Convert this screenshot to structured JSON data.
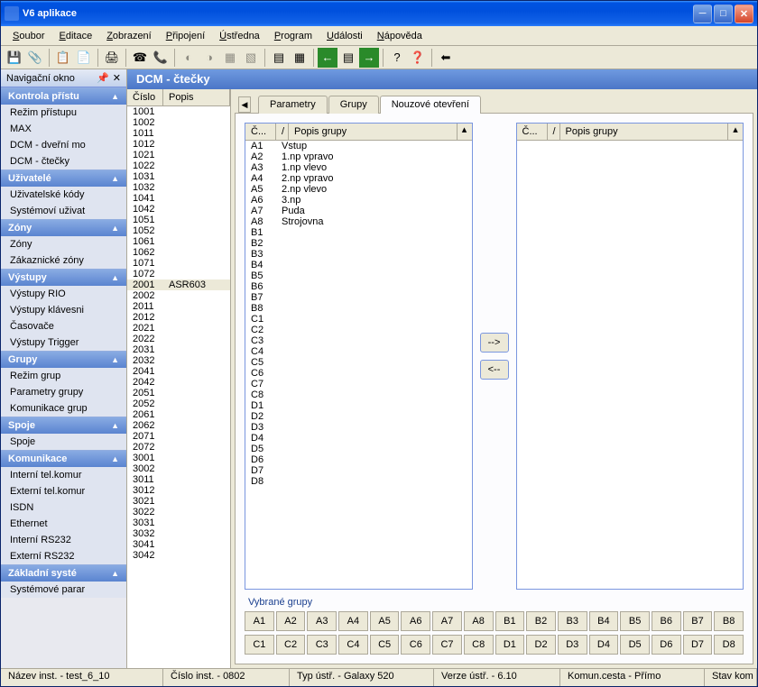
{
  "window": {
    "title": "V6 aplikace"
  },
  "menu": [
    "Soubor",
    "Editace",
    "Zobrazení",
    "Připojení",
    "Ústředna",
    "Program",
    "Události",
    "Nápověda"
  ],
  "nav": {
    "title": "Navigační okno",
    "sections": [
      {
        "title": "Kontrola přístu",
        "items": [
          "Režim přístupu",
          "MAX",
          "DCM - dveřní mo",
          "DCM - čtečky"
        ]
      },
      {
        "title": "Uživatelé",
        "items": [
          "Uživatelské kódy",
          "Systémoví uživat"
        ]
      },
      {
        "title": "Zóny",
        "items": [
          "Zóny",
          "Zákaznické zóny"
        ]
      },
      {
        "title": "Výstupy",
        "items": [
          "Výstupy RIO",
          "Výstupy klávesni",
          "Časovače",
          "Výstupy Trigger"
        ]
      },
      {
        "title": "Grupy",
        "items": [
          "Režim grup",
          "Parametry grupy",
          "Komunikace grup"
        ]
      },
      {
        "title": "Spoje",
        "items": [
          "Spoje"
        ]
      },
      {
        "title": "Komunikace",
        "items": [
          "Interní tel.komur",
          "Externí tel.komur",
          "ISDN",
          "Ethernet",
          "Interní RS232",
          "Externí RS232"
        ]
      },
      {
        "title": "Základní systé",
        "items": [
          "Systémové parar"
        ]
      }
    ]
  },
  "content": {
    "title": "DCM - čtečky",
    "listHeader": {
      "num": "Číslo",
      "desc": "Popis"
    },
    "rows": [
      {
        "n": "1001",
        "d": ""
      },
      {
        "n": "1002",
        "d": ""
      },
      {
        "n": "1011",
        "d": ""
      },
      {
        "n": "1012",
        "d": ""
      },
      {
        "n": "1021",
        "d": ""
      },
      {
        "n": "1022",
        "d": ""
      },
      {
        "n": "1031",
        "d": ""
      },
      {
        "n": "1032",
        "d": ""
      },
      {
        "n": "1041",
        "d": ""
      },
      {
        "n": "1042",
        "d": ""
      },
      {
        "n": "1051",
        "d": ""
      },
      {
        "n": "1052",
        "d": ""
      },
      {
        "n": "1061",
        "d": ""
      },
      {
        "n": "1062",
        "d": ""
      },
      {
        "n": "1071",
        "d": ""
      },
      {
        "n": "1072",
        "d": ""
      },
      {
        "n": "2001",
        "d": "ASR603"
      },
      {
        "n": "2002",
        "d": ""
      },
      {
        "n": "2011",
        "d": ""
      },
      {
        "n": "2012",
        "d": ""
      },
      {
        "n": "2021",
        "d": ""
      },
      {
        "n": "2022",
        "d": ""
      },
      {
        "n": "2031",
        "d": ""
      },
      {
        "n": "2032",
        "d": ""
      },
      {
        "n": "2041",
        "d": ""
      },
      {
        "n": "2042",
        "d": ""
      },
      {
        "n": "2051",
        "d": ""
      },
      {
        "n": "2052",
        "d": ""
      },
      {
        "n": "2061",
        "d": ""
      },
      {
        "n": "2062",
        "d": ""
      },
      {
        "n": "2071",
        "d": ""
      },
      {
        "n": "2072",
        "d": ""
      },
      {
        "n": "3001",
        "d": ""
      },
      {
        "n": "3002",
        "d": ""
      },
      {
        "n": "3011",
        "d": ""
      },
      {
        "n": "3012",
        "d": ""
      },
      {
        "n": "3021",
        "d": ""
      },
      {
        "n": "3022",
        "d": ""
      },
      {
        "n": "3031",
        "d": ""
      },
      {
        "n": "3032",
        "d": ""
      },
      {
        "n": "3041",
        "d": ""
      },
      {
        "n": "3042",
        "d": ""
      }
    ],
    "selectedRow": "2001",
    "tabs": [
      "Parametry",
      "Grupy",
      "Nouzové otevření"
    ],
    "activeTab": 2,
    "groupList": {
      "hdr": {
        "c1": "Č...",
        "c2": "/",
        "c3": "Popis grupy"
      },
      "left": [
        {
          "c": "A1",
          "d": "Vstup"
        },
        {
          "c": "A2",
          "d": "1.np vpravo"
        },
        {
          "c": "A3",
          "d": "1.np vlevo"
        },
        {
          "c": "A4",
          "d": "2.np vpravo"
        },
        {
          "c": "A5",
          "d": "2.np vlevo"
        },
        {
          "c": "A6",
          "d": "3.np"
        },
        {
          "c": "A7",
          "d": "Puda"
        },
        {
          "c": "A8",
          "d": "Strojovna"
        },
        {
          "c": "B1",
          "d": ""
        },
        {
          "c": "B2",
          "d": ""
        },
        {
          "c": "B3",
          "d": ""
        },
        {
          "c": "B4",
          "d": ""
        },
        {
          "c": "B5",
          "d": ""
        },
        {
          "c": "B6",
          "d": ""
        },
        {
          "c": "B7",
          "d": ""
        },
        {
          "c": "B8",
          "d": ""
        },
        {
          "c": "C1",
          "d": ""
        },
        {
          "c": "C2",
          "d": ""
        },
        {
          "c": "C3",
          "d": ""
        },
        {
          "c": "C4",
          "d": ""
        },
        {
          "c": "C5",
          "d": ""
        },
        {
          "c": "C6",
          "d": ""
        },
        {
          "c": "C7",
          "d": ""
        },
        {
          "c": "C8",
          "d": ""
        },
        {
          "c": "D1",
          "d": ""
        },
        {
          "c": "D2",
          "d": ""
        },
        {
          "c": "D3",
          "d": ""
        },
        {
          "c": "D4",
          "d": ""
        },
        {
          "c": "D5",
          "d": ""
        },
        {
          "c": "D6",
          "d": ""
        },
        {
          "c": "D7",
          "d": ""
        },
        {
          "c": "D8",
          "d": ""
        }
      ],
      "right": []
    },
    "moveBtns": {
      "right": "-->",
      "left": "<--"
    },
    "selGroups": {
      "label": "Vybrané grupy",
      "rows": [
        [
          "A1",
          "A2",
          "A3",
          "A4",
          "A5",
          "A6",
          "A7",
          "A8",
          "B1",
          "B2",
          "B3",
          "B4",
          "B5",
          "B6",
          "B7",
          "B8"
        ],
        [
          "C1",
          "C2",
          "C3",
          "C4",
          "C5",
          "C6",
          "C7",
          "C8",
          "D1",
          "D2",
          "D3",
          "D4",
          "D5",
          "D6",
          "D7",
          "D8"
        ]
      ]
    }
  },
  "status": [
    "Název inst.  - test_6_10",
    "Číslo inst.  - 0802",
    "Typ ústř.  - Galaxy 520",
    "Verze ústř.  - 6.10",
    "Komun.cesta  - Přímo",
    "Stav kom"
  ]
}
